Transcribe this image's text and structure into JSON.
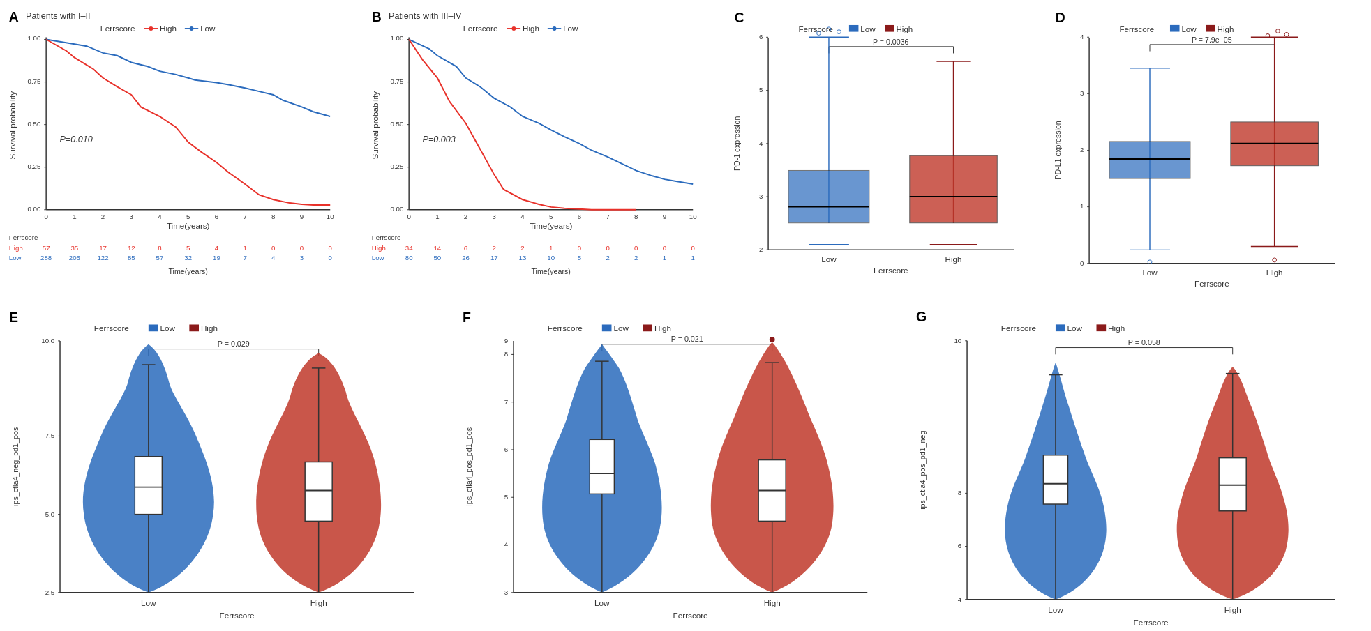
{
  "panels": {
    "A": {
      "label": "A",
      "title": "Patients with I–II",
      "legend": {
        "label": "Ferrscore",
        "high": "High",
        "low": "Low"
      },
      "pvalue": "P=0.010",
      "xaxis": "Time(years)",
      "yaxis": "Survival probability",
      "table": {
        "rows": [
          {
            "name": "High",
            "values": [
              "57",
              "35",
              "17",
              "12",
              "8",
              "5",
              "4",
              "1",
              "0",
              "0",
              "0"
            ]
          },
          {
            "name": "Low",
            "values": [
              "288",
              "205",
              "122",
              "85",
              "57",
              "32",
              "19",
              "7",
              "4",
              "3",
              "0"
            ]
          }
        ],
        "xlabel": "Time(years)"
      }
    },
    "B": {
      "label": "B",
      "title": "Patients with III–IV",
      "legend": {
        "label": "Ferrscore",
        "high": "High",
        "low": "Low"
      },
      "pvalue": "P=0.003",
      "xaxis": "Time(years)",
      "yaxis": "Survival probability",
      "table": {
        "rows": [
          {
            "name": "High",
            "values": [
              "34",
              "14",
              "6",
              "2",
              "2",
              "1",
              "0",
              "0",
              "0",
              "0",
              "0"
            ]
          },
          {
            "name": "Low",
            "values": [
              "80",
              "50",
              "26",
              "17",
              "13",
              "10",
              "5",
              "2",
              "2",
              "1",
              "1"
            ]
          }
        ],
        "xlabel": "Time(years)"
      }
    },
    "C": {
      "label": "C",
      "legend": {
        "label": "Ferrscore",
        "low": "Low",
        "high": "High"
      },
      "pvalue": "P = 0.0036",
      "xaxis": "Ferrscore",
      "yaxis": "PD-1 expression"
    },
    "D": {
      "label": "D",
      "legend": {
        "label": "Ferrscore",
        "low": "Low",
        "high": "High"
      },
      "pvalue": "P = 7.9e−05",
      "xaxis": "Ferrscore",
      "yaxis": "PD-L1 expression"
    },
    "E": {
      "label": "E",
      "legend": {
        "label": "Ferrscore",
        "low": "Low",
        "high": "High"
      },
      "pvalue": "P = 0.029",
      "xaxis": "Ferrscore",
      "yaxis": "ips_ctla4_neg_pd1_pos"
    },
    "F": {
      "label": "F",
      "legend": {
        "label": "Ferrscore",
        "low": "Low",
        "high": "High"
      },
      "pvalue": "P = 0.021",
      "xaxis": "Ferrscore",
      "yaxis": "ips_ctla4_pos_pd1_pos"
    },
    "G": {
      "label": "G",
      "legend": {
        "label": "Ferrscore",
        "low": "Low",
        "high": "High"
      },
      "pvalue": "P = 0.058",
      "xaxis": "Ferrscore",
      "yaxis": "ips_ctla4_pos_pd1_neg"
    }
  },
  "colors": {
    "high": "#e8312a",
    "low": "#2b6bbd",
    "blue": "#2b6bbd",
    "red": "#e8312a"
  }
}
